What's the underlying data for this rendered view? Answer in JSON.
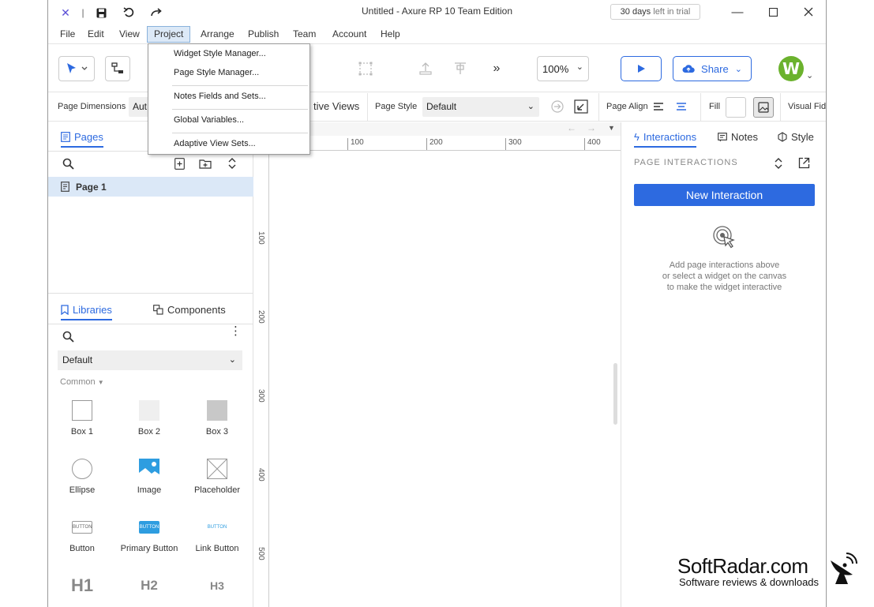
{
  "window": {
    "title": "Untitled - Axure RP 10 Team Edition",
    "trial_days": "30 days",
    "trial_rest": "left in trial"
  },
  "menu": {
    "items": [
      "File",
      "Edit",
      "View",
      "Project",
      "Arrange",
      "Publish",
      "Team",
      "Account",
      "Help"
    ],
    "active": "Project"
  },
  "project_menu": {
    "items": [
      "Widget Style Manager...",
      "Page Style Manager...",
      "Notes Fields and Sets...",
      "Global Variables...",
      "Adaptive View Sets..."
    ]
  },
  "toolbar": {
    "zoom": "100%",
    "share_label": "Share",
    "avatar_letter": "W"
  },
  "propbar": {
    "page_dimensions_label": "Page Dimensions",
    "page_dimensions_value": "Aut",
    "adaptive_views_partial": "tive Views",
    "page_style_label": "Page Style",
    "page_style_value": "Default",
    "page_align_label": "Page Align",
    "fill_label": "Fill",
    "visual_fidelity_partial": "Visual Fide"
  },
  "pages_panel": {
    "tab_label": "Pages",
    "page_name": "Page 1"
  },
  "libraries_panel": {
    "tab_label": "Libraries",
    "components_tab": "Components",
    "library_value": "Default",
    "section": "Common",
    "widgets": [
      "Box 1",
      "Box 2",
      "Box 3",
      "Ellipse",
      "Image",
      "Placeholder",
      "Button",
      "Primary Button",
      "Link Button",
      "H1",
      "H2",
      "H3"
    ],
    "button_thumb_text": "BUTTON"
  },
  "canvas": {
    "ruler_h": [
      "100",
      "200",
      "300",
      "400"
    ],
    "ruler_v": [
      "100",
      "200",
      "300",
      "400",
      "500"
    ]
  },
  "right_panel": {
    "tabs": [
      "Interactions",
      "Notes",
      "Style"
    ],
    "active_tab": "Interactions",
    "section_title": "PAGE INTERACTIONS",
    "new_interaction": "New Interaction",
    "hint_line1": "Add page interactions above",
    "hint_line2": "or select a widget on the canvas",
    "hint_line3": "to make the widget interactive"
  },
  "watermark": {
    "brand": "SoftRadar.com",
    "tagline": "Software reviews & downloads"
  },
  "colors": {
    "accent": "#2d6ae0",
    "avatar": "#6bb22d",
    "selected_row": "#dbe8f7"
  }
}
